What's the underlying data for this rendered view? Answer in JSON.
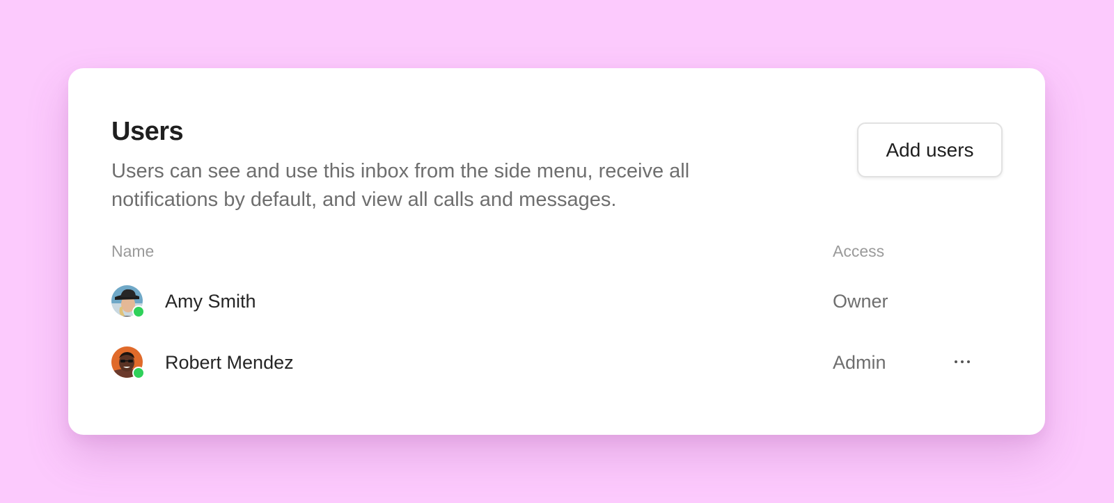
{
  "colors": {
    "background": "#fccafd",
    "card": "#ffffff",
    "title": "#1f1f1f",
    "muted_text": "#6e6e6e",
    "header_text": "#9a9a9a",
    "online_status": "#2fd15a"
  },
  "card": {
    "title": "Users",
    "description": "Users can see and use this inbox from the side menu, receive all notifications by default, and view all calls and messages.",
    "add_button_label": "Add users"
  },
  "table": {
    "columns": {
      "name": "Name",
      "access": "Access"
    },
    "rows": [
      {
        "name": "Amy Smith",
        "access": "Owner",
        "status": "online",
        "avatar_icon": "avatar-photo-icon"
      },
      {
        "name": "Robert Mendez",
        "access": "Admin",
        "status": "online",
        "avatar_icon": "avatar-photo-icon",
        "more_icon": "more-horizontal-icon"
      }
    ]
  }
}
